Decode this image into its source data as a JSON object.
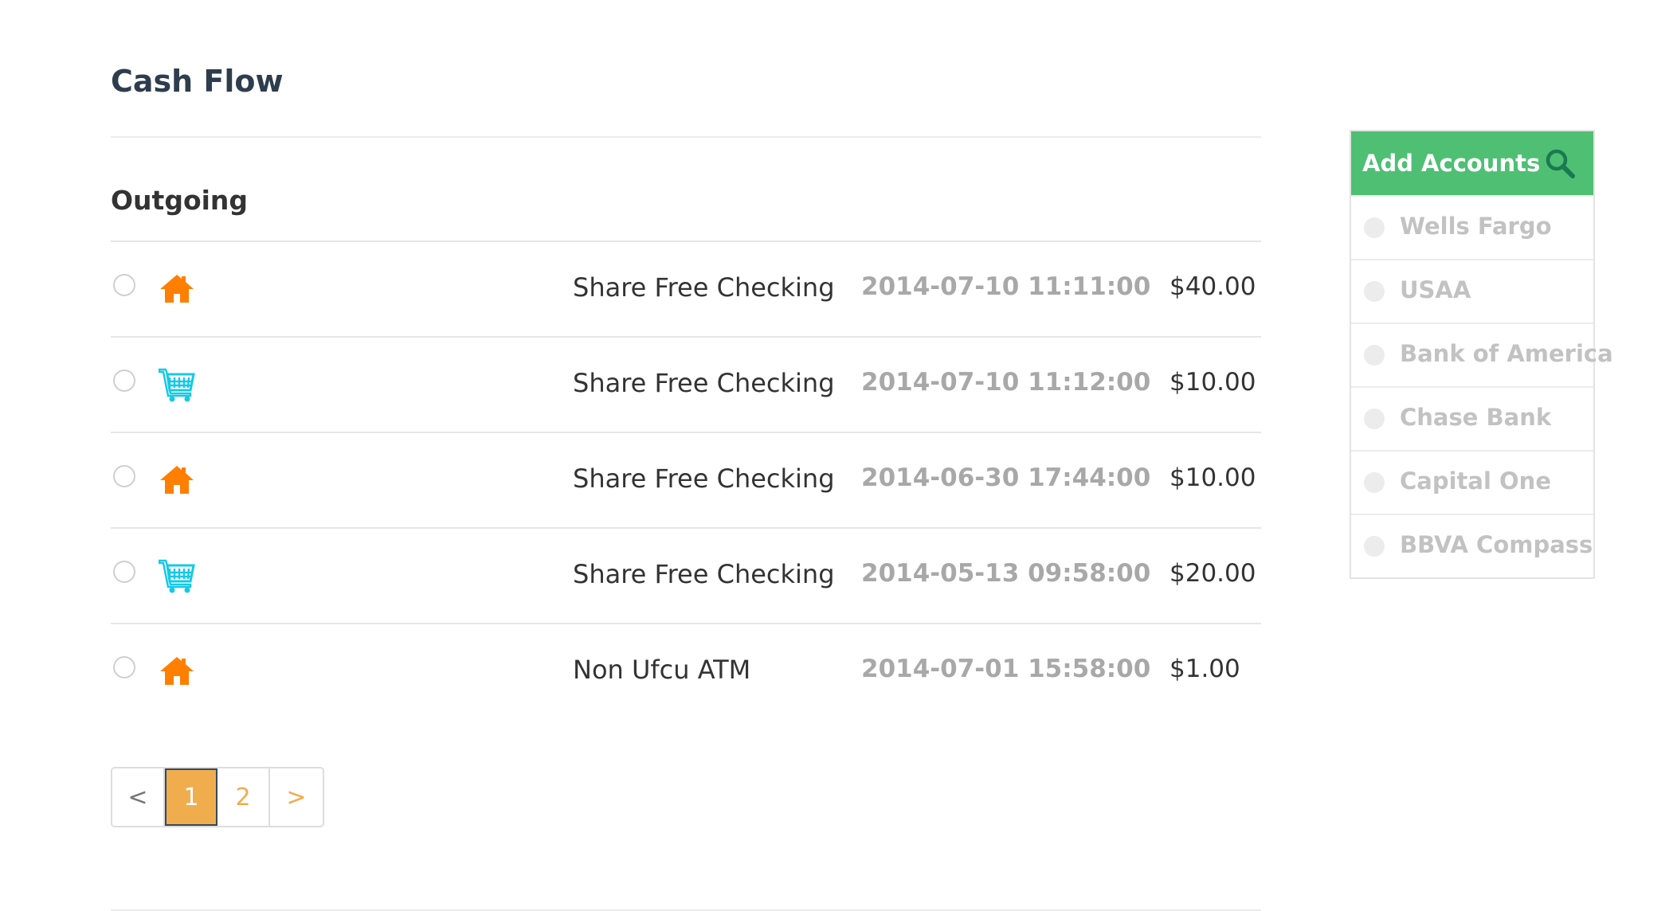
{
  "header": {
    "title": "Cash Flow"
  },
  "section": {
    "title": "Outgoing"
  },
  "transactions": [
    {
      "icon": "home-icon",
      "account": "Share Free Checking",
      "datetime": "2014-07-10 11:11:00",
      "amount": "$40.00"
    },
    {
      "icon": "shopping-cart-icon",
      "account": "Share Free Checking",
      "datetime": "2014-07-10 11:12:00",
      "amount": "$10.00"
    },
    {
      "icon": "home-icon",
      "account": "Share Free Checking",
      "datetime": "2014-06-30 17:44:00",
      "amount": "$10.00"
    },
    {
      "icon": "shopping-cart-icon",
      "account": "Share Free Checking",
      "datetime": "2014-05-13 09:58:00",
      "amount": "$20.00"
    },
    {
      "icon": "home-icon",
      "account": "Non Ufcu ATM",
      "datetime": "2014-07-01 15:58:00",
      "amount": "$1.00"
    }
  ],
  "pagination": {
    "prev": "<",
    "pages": [
      "1",
      "2"
    ],
    "active": "1",
    "next": ">"
  },
  "sidebar": {
    "title": "Add Accounts",
    "search_icon": "search-icon",
    "banks": [
      "Wells Fargo",
      "USAA",
      "Bank of America",
      "Chase Bank",
      "Capital One",
      "BBVA Compass"
    ]
  },
  "colors": {
    "home_icon": "#ff7f00",
    "cart_icon": "#17c9e6",
    "sidebar_header": "#4fbf74",
    "search_icon": "#1a7a4f",
    "pagination_active": "#f0ad4e"
  }
}
